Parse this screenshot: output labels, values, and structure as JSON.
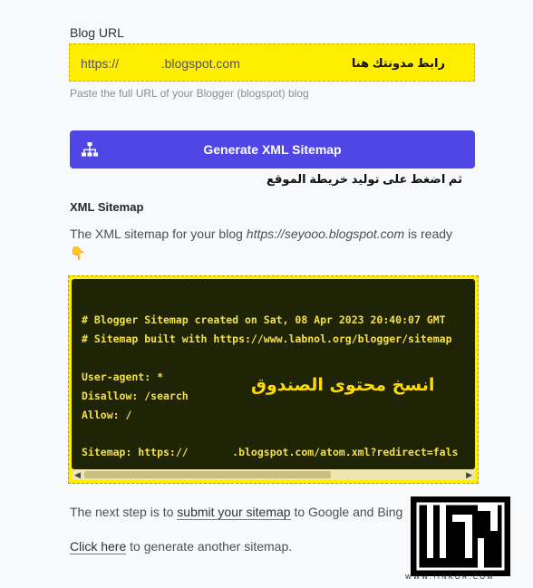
{
  "form": {
    "blog_url_label": "Blog URL",
    "blog_url_value": "https://            .blogspot.com",
    "blog_url_note": "رابط مدونتك هنا",
    "blog_url_help": "Paste the full URL of your Blogger (blogspot) blog",
    "generate_label": "Generate XML Sitemap",
    "generate_note": "ثم اضغط على توليد خريطة الموقع"
  },
  "result": {
    "heading": "XML Sitemap",
    "desc_prefix": "The XML sitemap for your blog ",
    "desc_url": "https://seyooo.blogspot.com",
    "desc_suffix": " is ready",
    "emoji": "👇",
    "code_lines": [
      "# Blogger Sitemap created on Sat, 08 Apr 2023 20:40:07 GMT",
      "# Sitemap built with https://www.labnol.org/blogger/sitemap",
      "",
      "User-agent: *",
      "Disallow: /search",
      "Allow: /",
      "",
      "Sitemap: https://       .blogspot.com/atom.xml?redirect=fals"
    ],
    "code_note": "انسخ محتوى الصندوق"
  },
  "footer": {
    "next_prefix": "The next step is to ",
    "next_link": "submit your sitemap",
    "next_suffix": " to Google and Bing",
    "again_link": "Click here",
    "again_suffix": " to generate another sitemap."
  },
  "watermark": {
    "url": "WWW.IINKOR.COM"
  },
  "colors": {
    "accent": "#5046e5",
    "highlight": "#ffee00",
    "code_bg": "#1f2406",
    "code_text": "#f4e14a"
  }
}
